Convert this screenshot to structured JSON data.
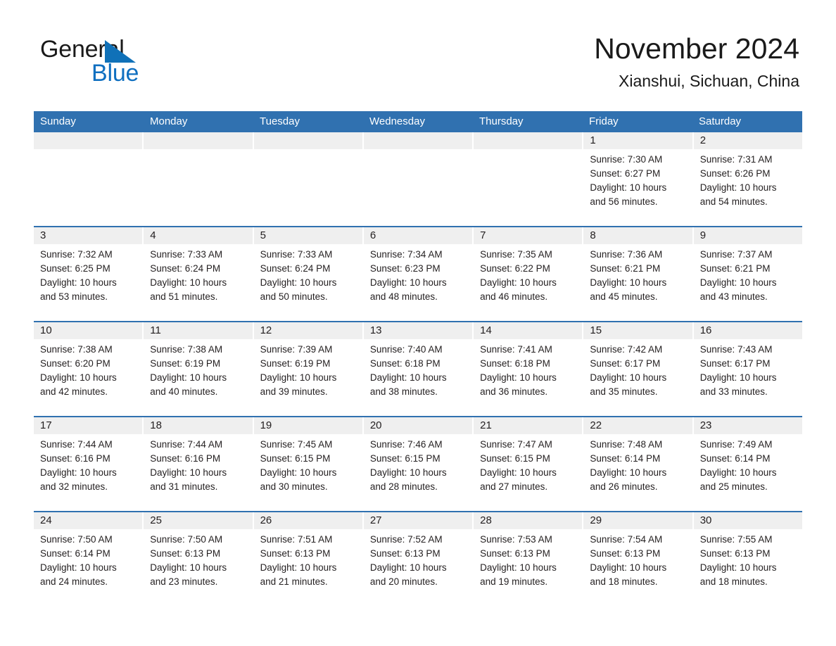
{
  "brand": {
    "name_part1": "General",
    "name_part2": "Blue",
    "triangle_color": "#1071b8",
    "part1_color": "#1a1a1a",
    "part2_color": "#0f6fc0"
  },
  "header": {
    "month_title": "November 2024",
    "location": "Xianshui, Sichuan, China"
  },
  "colors": {
    "header_blue": "#3071b0",
    "day_band_gray": "#efefef",
    "text": "#231f20",
    "cell_background": "#ffffff"
  },
  "weekdays": [
    "Sunday",
    "Monday",
    "Tuesday",
    "Wednesday",
    "Thursday",
    "Friday",
    "Saturday"
  ],
  "weeks": [
    {
      "days": [
        {
          "number": "",
          "blank": true,
          "sunrise": "",
          "sunset": "",
          "daylight_line1": "",
          "daylight_line2": ""
        },
        {
          "number": "",
          "blank": true,
          "sunrise": "",
          "sunset": "",
          "daylight_line1": "",
          "daylight_line2": ""
        },
        {
          "number": "",
          "blank": true,
          "sunrise": "",
          "sunset": "",
          "daylight_line1": "",
          "daylight_line2": ""
        },
        {
          "number": "",
          "blank": true,
          "sunrise": "",
          "sunset": "",
          "daylight_line1": "",
          "daylight_line2": ""
        },
        {
          "number": "",
          "blank": true,
          "sunrise": "",
          "sunset": "",
          "daylight_line1": "",
          "daylight_line2": ""
        },
        {
          "number": "1",
          "blank": false,
          "sunrise": "Sunrise: 7:30 AM",
          "sunset": "Sunset: 6:27 PM",
          "daylight_line1": "Daylight: 10 hours",
          "daylight_line2": "and 56 minutes."
        },
        {
          "number": "2",
          "blank": false,
          "sunrise": "Sunrise: 7:31 AM",
          "sunset": "Sunset: 6:26 PM",
          "daylight_line1": "Daylight: 10 hours",
          "daylight_line2": "and 54 minutes."
        }
      ]
    },
    {
      "days": [
        {
          "number": "3",
          "blank": false,
          "sunrise": "Sunrise: 7:32 AM",
          "sunset": "Sunset: 6:25 PM",
          "daylight_line1": "Daylight: 10 hours",
          "daylight_line2": "and 53 minutes."
        },
        {
          "number": "4",
          "blank": false,
          "sunrise": "Sunrise: 7:33 AM",
          "sunset": "Sunset: 6:24 PM",
          "daylight_line1": "Daylight: 10 hours",
          "daylight_line2": "and 51 minutes."
        },
        {
          "number": "5",
          "blank": false,
          "sunrise": "Sunrise: 7:33 AM",
          "sunset": "Sunset: 6:24 PM",
          "daylight_line1": "Daylight: 10 hours",
          "daylight_line2": "and 50 minutes."
        },
        {
          "number": "6",
          "blank": false,
          "sunrise": "Sunrise: 7:34 AM",
          "sunset": "Sunset: 6:23 PM",
          "daylight_line1": "Daylight: 10 hours",
          "daylight_line2": "and 48 minutes."
        },
        {
          "number": "7",
          "blank": false,
          "sunrise": "Sunrise: 7:35 AM",
          "sunset": "Sunset: 6:22 PM",
          "daylight_line1": "Daylight: 10 hours",
          "daylight_line2": "and 46 minutes."
        },
        {
          "number": "8",
          "blank": false,
          "sunrise": "Sunrise: 7:36 AM",
          "sunset": "Sunset: 6:21 PM",
          "daylight_line1": "Daylight: 10 hours",
          "daylight_line2": "and 45 minutes."
        },
        {
          "number": "9",
          "blank": false,
          "sunrise": "Sunrise: 7:37 AM",
          "sunset": "Sunset: 6:21 PM",
          "daylight_line1": "Daylight: 10 hours",
          "daylight_line2": "and 43 minutes."
        }
      ]
    },
    {
      "days": [
        {
          "number": "10",
          "blank": false,
          "sunrise": "Sunrise: 7:38 AM",
          "sunset": "Sunset: 6:20 PM",
          "daylight_line1": "Daylight: 10 hours",
          "daylight_line2": "and 42 minutes."
        },
        {
          "number": "11",
          "blank": false,
          "sunrise": "Sunrise: 7:38 AM",
          "sunset": "Sunset: 6:19 PM",
          "daylight_line1": "Daylight: 10 hours",
          "daylight_line2": "and 40 minutes."
        },
        {
          "number": "12",
          "blank": false,
          "sunrise": "Sunrise: 7:39 AM",
          "sunset": "Sunset: 6:19 PM",
          "daylight_line1": "Daylight: 10 hours",
          "daylight_line2": "and 39 minutes."
        },
        {
          "number": "13",
          "blank": false,
          "sunrise": "Sunrise: 7:40 AM",
          "sunset": "Sunset: 6:18 PM",
          "daylight_line1": "Daylight: 10 hours",
          "daylight_line2": "and 38 minutes."
        },
        {
          "number": "14",
          "blank": false,
          "sunrise": "Sunrise: 7:41 AM",
          "sunset": "Sunset: 6:18 PM",
          "daylight_line1": "Daylight: 10 hours",
          "daylight_line2": "and 36 minutes."
        },
        {
          "number": "15",
          "blank": false,
          "sunrise": "Sunrise: 7:42 AM",
          "sunset": "Sunset: 6:17 PM",
          "daylight_line1": "Daylight: 10 hours",
          "daylight_line2": "and 35 minutes."
        },
        {
          "number": "16",
          "blank": false,
          "sunrise": "Sunrise: 7:43 AM",
          "sunset": "Sunset: 6:17 PM",
          "daylight_line1": "Daylight: 10 hours",
          "daylight_line2": "and 33 minutes."
        }
      ]
    },
    {
      "days": [
        {
          "number": "17",
          "blank": false,
          "sunrise": "Sunrise: 7:44 AM",
          "sunset": "Sunset: 6:16 PM",
          "daylight_line1": "Daylight: 10 hours",
          "daylight_line2": "and 32 minutes."
        },
        {
          "number": "18",
          "blank": false,
          "sunrise": "Sunrise: 7:44 AM",
          "sunset": "Sunset: 6:16 PM",
          "daylight_line1": "Daylight: 10 hours",
          "daylight_line2": "and 31 minutes."
        },
        {
          "number": "19",
          "blank": false,
          "sunrise": "Sunrise: 7:45 AM",
          "sunset": "Sunset: 6:15 PM",
          "daylight_line1": "Daylight: 10 hours",
          "daylight_line2": "and 30 minutes."
        },
        {
          "number": "20",
          "blank": false,
          "sunrise": "Sunrise: 7:46 AM",
          "sunset": "Sunset: 6:15 PM",
          "daylight_line1": "Daylight: 10 hours",
          "daylight_line2": "and 28 minutes."
        },
        {
          "number": "21",
          "blank": false,
          "sunrise": "Sunrise: 7:47 AM",
          "sunset": "Sunset: 6:15 PM",
          "daylight_line1": "Daylight: 10 hours",
          "daylight_line2": "and 27 minutes."
        },
        {
          "number": "22",
          "blank": false,
          "sunrise": "Sunrise: 7:48 AM",
          "sunset": "Sunset: 6:14 PM",
          "daylight_line1": "Daylight: 10 hours",
          "daylight_line2": "and 26 minutes."
        },
        {
          "number": "23",
          "blank": false,
          "sunrise": "Sunrise: 7:49 AM",
          "sunset": "Sunset: 6:14 PM",
          "daylight_line1": "Daylight: 10 hours",
          "daylight_line2": "and 25 minutes."
        }
      ]
    },
    {
      "days": [
        {
          "number": "24",
          "blank": false,
          "sunrise": "Sunrise: 7:50 AM",
          "sunset": "Sunset: 6:14 PM",
          "daylight_line1": "Daylight: 10 hours",
          "daylight_line2": "and 24 minutes."
        },
        {
          "number": "25",
          "blank": false,
          "sunrise": "Sunrise: 7:50 AM",
          "sunset": "Sunset: 6:13 PM",
          "daylight_line1": "Daylight: 10 hours",
          "daylight_line2": "and 23 minutes."
        },
        {
          "number": "26",
          "blank": false,
          "sunrise": "Sunrise: 7:51 AM",
          "sunset": "Sunset: 6:13 PM",
          "daylight_line1": "Daylight: 10 hours",
          "daylight_line2": "and 21 minutes."
        },
        {
          "number": "27",
          "blank": false,
          "sunrise": "Sunrise: 7:52 AM",
          "sunset": "Sunset: 6:13 PM",
          "daylight_line1": "Daylight: 10 hours",
          "daylight_line2": "and 20 minutes."
        },
        {
          "number": "28",
          "blank": false,
          "sunrise": "Sunrise: 7:53 AM",
          "sunset": "Sunset: 6:13 PM",
          "daylight_line1": "Daylight: 10 hours",
          "daylight_line2": "and 19 minutes."
        },
        {
          "number": "29",
          "blank": false,
          "sunrise": "Sunrise: 7:54 AM",
          "sunset": "Sunset: 6:13 PM",
          "daylight_line1": "Daylight: 10 hours",
          "daylight_line2": "and 18 minutes."
        },
        {
          "number": "30",
          "blank": false,
          "sunrise": "Sunrise: 7:55 AM",
          "sunset": "Sunset: 6:13 PM",
          "daylight_line1": "Daylight: 10 hours",
          "daylight_line2": "and 18 minutes."
        }
      ]
    }
  ]
}
